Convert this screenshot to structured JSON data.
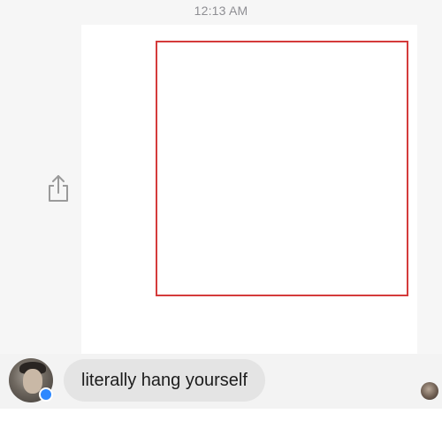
{
  "header": {
    "timestamp": "12:13 AM"
  },
  "thread": {
    "shared_image": {
      "frame_color": "#d43b3b"
    },
    "share_action": {
      "icon": "share-icon"
    },
    "incoming_message": {
      "text": "literally hang yourself",
      "sender_avatar_icon": "avatar",
      "badge_icon": "messenger-icon"
    },
    "read_receipt": {
      "icon": "seen-avatar"
    }
  },
  "colors": {
    "bubble": "#e4e4e4",
    "badge": "#2d88ff",
    "timestamp": "#8e8e93"
  }
}
